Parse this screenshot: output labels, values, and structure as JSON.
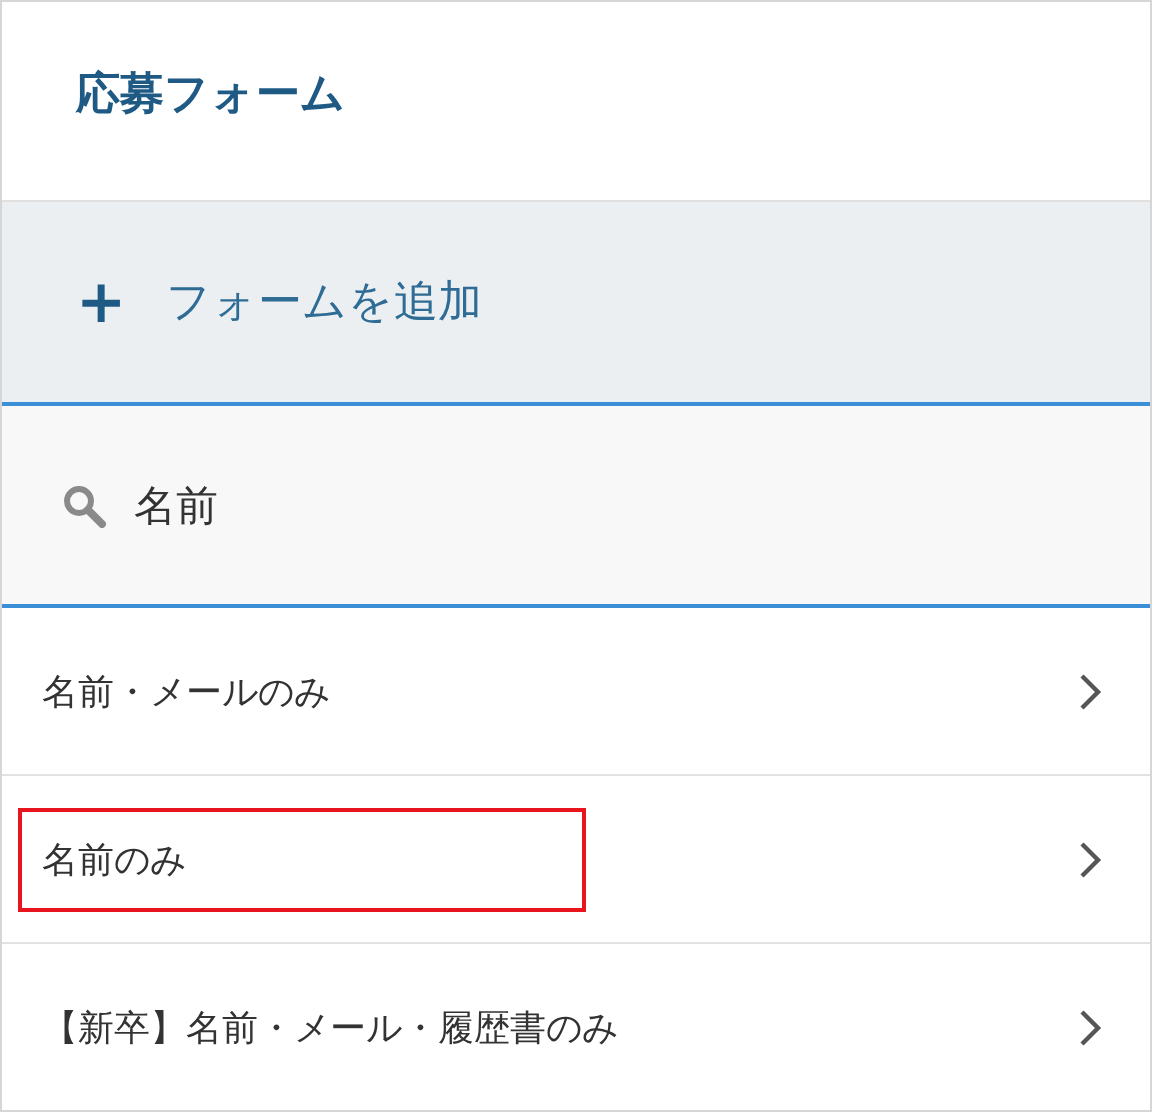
{
  "header": {
    "title": "応募フォーム"
  },
  "add_button": {
    "icon": "+",
    "label": "フォームを追加"
  },
  "search": {
    "value": "名前"
  },
  "forms": [
    {
      "label": "名前・メールのみ",
      "highlighted": false
    },
    {
      "label": "名前のみ",
      "highlighted": true
    },
    {
      "label": "【新卒】名前・メール・履歴書のみ",
      "highlighted": false
    }
  ]
}
